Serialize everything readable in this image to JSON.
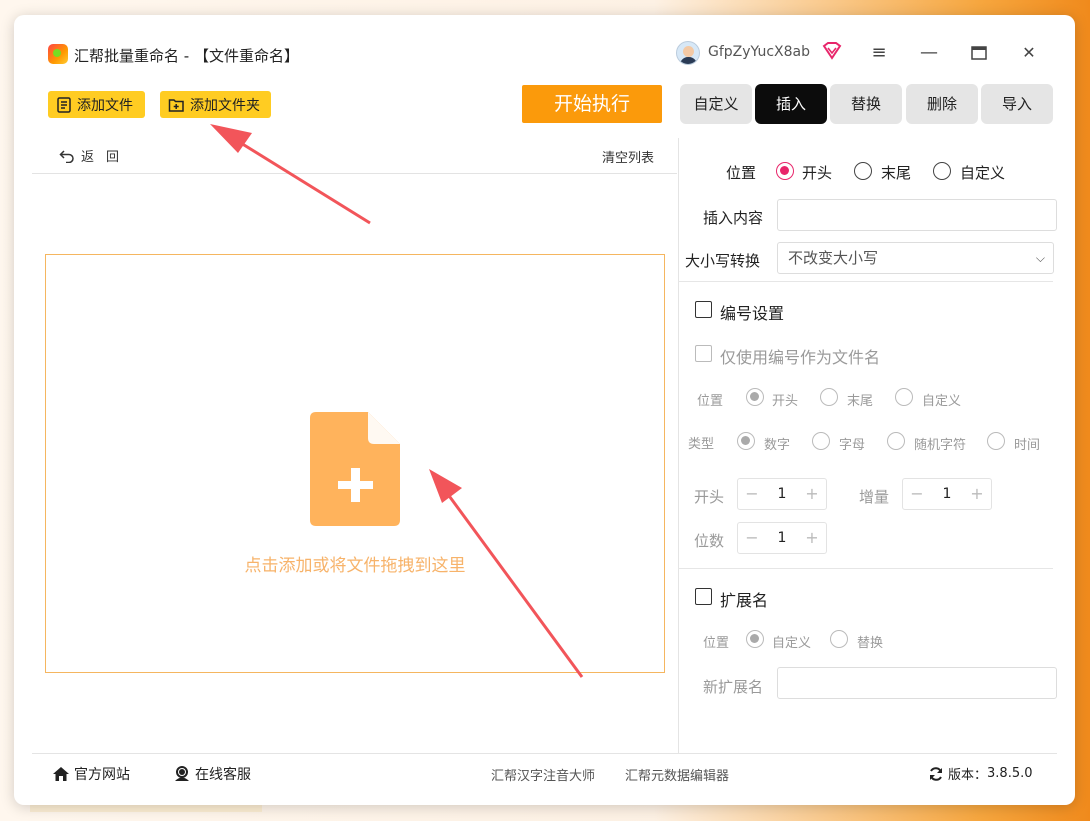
{
  "app": {
    "title": "汇帮批量重命名 - 【文件重命名】",
    "username": "GfpZyYucX8ab"
  },
  "window_controls": {
    "menu": "≡",
    "minimize": "—",
    "maximize": "□",
    "close": "✕"
  },
  "toolbar": {
    "add_file": "添加文件",
    "add_folder": "添加文件夹",
    "start": "开始执行"
  },
  "list": {
    "back": "返回",
    "clear": "清空列表",
    "drop_hint": "点击添加或将文件拖拽到这里"
  },
  "tabs": [
    {
      "label": "自定义",
      "active": false
    },
    {
      "label": "插入",
      "active": true
    },
    {
      "label": "替换",
      "active": false
    },
    {
      "label": "删除",
      "active": false
    },
    {
      "label": "导入",
      "active": false
    }
  ],
  "insert": {
    "position_label": "位置",
    "position_options": [
      "开头",
      "末尾",
      "自定义"
    ],
    "position_selected": "开头",
    "content_label": "插入内容",
    "content_value": "",
    "case_label": "大小写转换",
    "case_value": "不改变大小写"
  },
  "numbering": {
    "title": "编号设置",
    "only_number": "仅使用编号作为文件名",
    "position_label": "位置",
    "position_options": [
      "开头",
      "末尾",
      "自定义"
    ],
    "type_label": "类型",
    "type_options": [
      "数字",
      "字母",
      "随机字符",
      "时间"
    ],
    "start_label": "开头",
    "start_value": "1",
    "increment_label": "增量",
    "increment_value": "1",
    "digits_label": "位数",
    "digits_value": "1"
  },
  "extension": {
    "title": "扩展名",
    "position_label": "位置",
    "options": [
      "自定义",
      "替换"
    ],
    "new_ext_label": "新扩展名",
    "new_ext_value": ""
  },
  "footer": {
    "website": "官方网站",
    "support": "在线客服",
    "link1": "汇帮汉字注音大师",
    "link2": "汇帮元数据编辑器",
    "version_label": "版本：",
    "version": "3.8.5.0"
  },
  "colors": {
    "accent": "#fb9a0b",
    "button_yellow": "#ffcc22",
    "radio_selected": "#e8266b",
    "drop_border": "#f5b660",
    "arrow": "#f2555a"
  }
}
